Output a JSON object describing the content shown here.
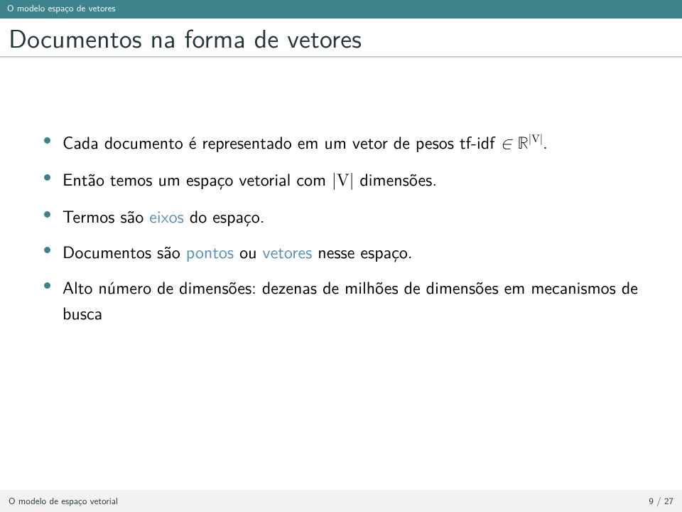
{
  "header": {
    "section": "O modelo espaço de vetores"
  },
  "title": "Documentos na forma de vetores",
  "bullets": [
    {
      "pre": "Cada documento é representado em um vetor de pesos tf-idf ",
      "math_prefix": "∈ ",
      "math_R": "ℝ",
      "math_sup": "|V|",
      "post": "."
    },
    {
      "pre": "Então temos um espaço vetorial com ",
      "math_var": "|V|",
      "post": " dimensões."
    },
    {
      "text1": "Termos são ",
      "hl1": "eixos",
      "text2": " do espaço."
    },
    {
      "text1": "Documentos são ",
      "hl1": "pontos",
      "text2": " ou ",
      "hl2": "vetores",
      "text3": " nesse espaço."
    },
    {
      "text": "Alto número de dimensões: dezenas de milhões de dimensões em mecanismos de busca"
    }
  ],
  "footer": {
    "left": "O modelo de espaço vetorial",
    "right": "9 / 27"
  }
}
